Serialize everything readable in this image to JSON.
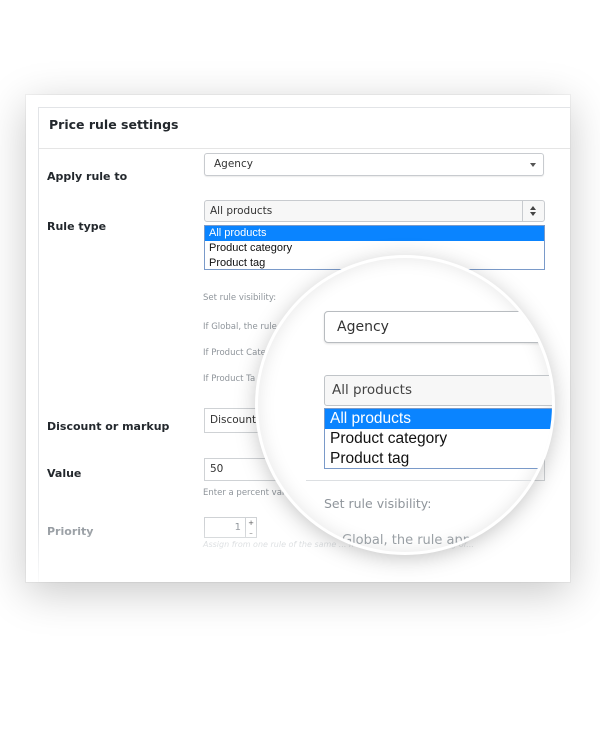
{
  "panel": {
    "title": "Price rule settings"
  },
  "fields": {
    "apply_rule_to": {
      "label": "Apply rule to",
      "value": "Agency"
    },
    "rule_type": {
      "label": "Rule type",
      "value": "All products",
      "options": [
        "All products",
        "Product category",
        "Product tag"
      ]
    },
    "visibility": {
      "heading": "Set rule visibility:",
      "lines": [
        "If Global, the rule",
        "If Product Cate",
        "If Product Ta"
      ]
    },
    "discount_or_markup": {
      "label": "Discount or markup",
      "value": "Discount %"
    },
    "value": {
      "label": "Value",
      "value": "50",
      "helper": "Enter a percent valu"
    },
    "priority": {
      "label": "Priority",
      "value": "1",
      "helper": "Assign from one rule of the same ... If a cascade of product tag or..."
    }
  },
  "magnifier": {
    "agency": "Agency",
    "rule_type_value": "All products",
    "options": [
      "All products",
      "Product category",
      "Product tag"
    ],
    "visibility": "Set rule visibility:",
    "global_line": "Global, the rule app"
  }
}
